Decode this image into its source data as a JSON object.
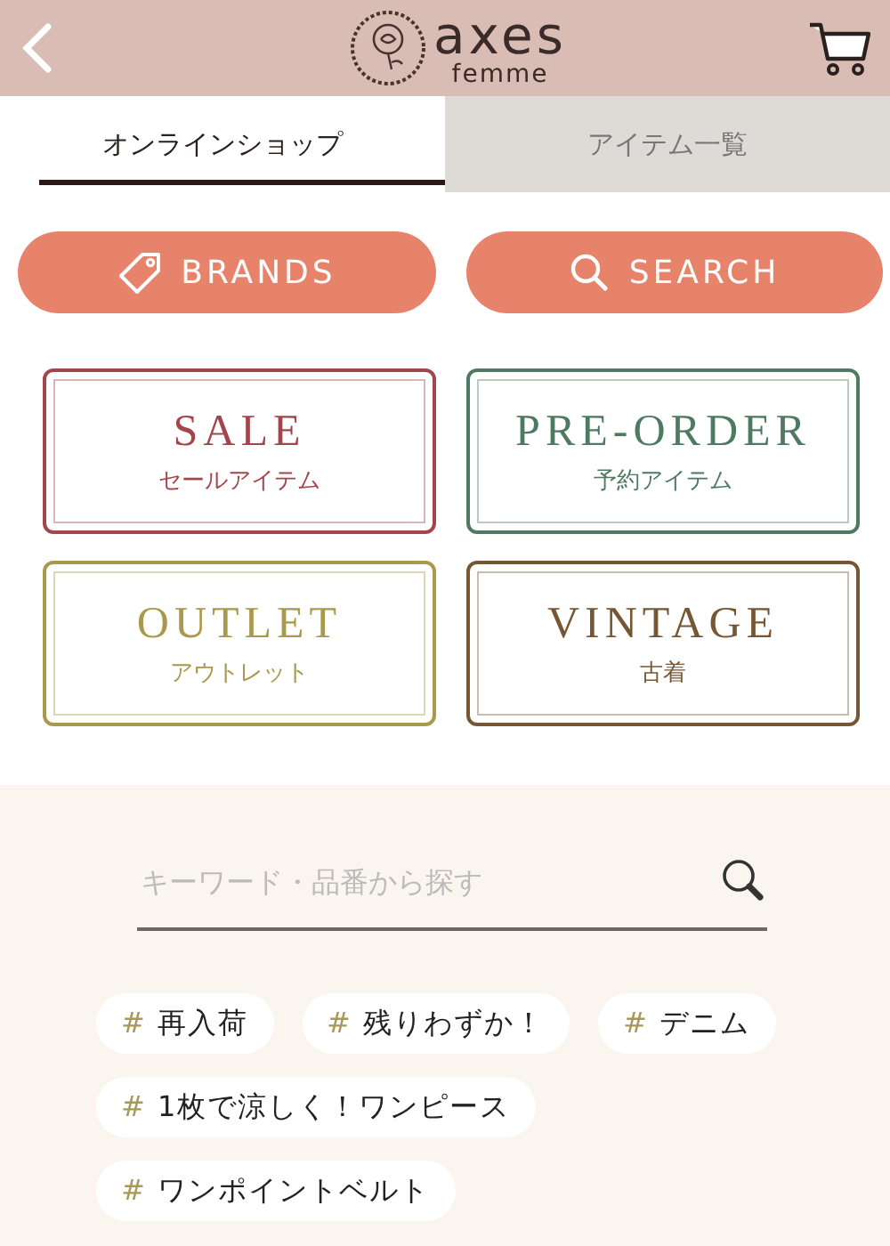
{
  "header": {
    "logo_top": "axes",
    "logo_bottom": "femme"
  },
  "tabs": [
    {
      "label": "オンラインショップ",
      "selected": true
    },
    {
      "label": "アイテム一覧",
      "selected": false
    }
  ],
  "buttons": [
    {
      "label": "BRANDS",
      "kind": "tag"
    },
    {
      "label": "SEARCH",
      "kind": "search"
    }
  ],
  "categories": [
    {
      "title": "SALE",
      "subtitle": "セールアイテム",
      "color": "#a3464b"
    },
    {
      "title": "PRE-ORDER",
      "subtitle": "予約アイテム",
      "color": "#4f7a62"
    },
    {
      "title": "OUTLET",
      "subtitle": "アウトレット",
      "color": "#a8994c"
    },
    {
      "title": "VINTAGE",
      "subtitle": "古着",
      "color": "#775733"
    }
  ],
  "search": {
    "placeholder": "キーワード・品番から探す"
  },
  "tags": [
    {
      "hash": "#",
      "label": "再入荷"
    },
    {
      "hash": "#",
      "label": "残りわずか！"
    },
    {
      "hash": "#",
      "label": "デニム"
    },
    {
      "hash": "#",
      "label": "1枚で涼しく！ワンピース"
    },
    {
      "hash": "#",
      "label": "ワンポイントベルト"
    }
  ]
}
